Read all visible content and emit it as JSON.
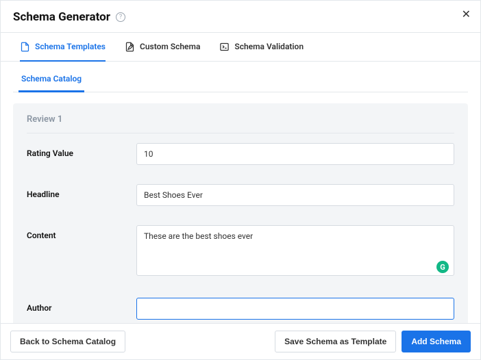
{
  "header": {
    "title": "Schema Generator"
  },
  "tabs": {
    "templates": "Schema Templates",
    "custom": "Custom Schema",
    "validation": "Schema Validation"
  },
  "subtabs": {
    "catalog": "Schema Catalog"
  },
  "panel": {
    "title": "Review 1",
    "fields": {
      "rating": {
        "label": "Rating Value",
        "value": "10"
      },
      "headline": {
        "label": "Headline",
        "value": "Best Shoes Ever"
      },
      "content": {
        "label": "Content",
        "value": "These are the best shoes ever"
      },
      "author": {
        "label": "Author",
        "value": ""
      }
    }
  },
  "footer": {
    "back": "Back to Schema Catalog",
    "save": "Save Schema as Template",
    "add": "Add Schema"
  }
}
